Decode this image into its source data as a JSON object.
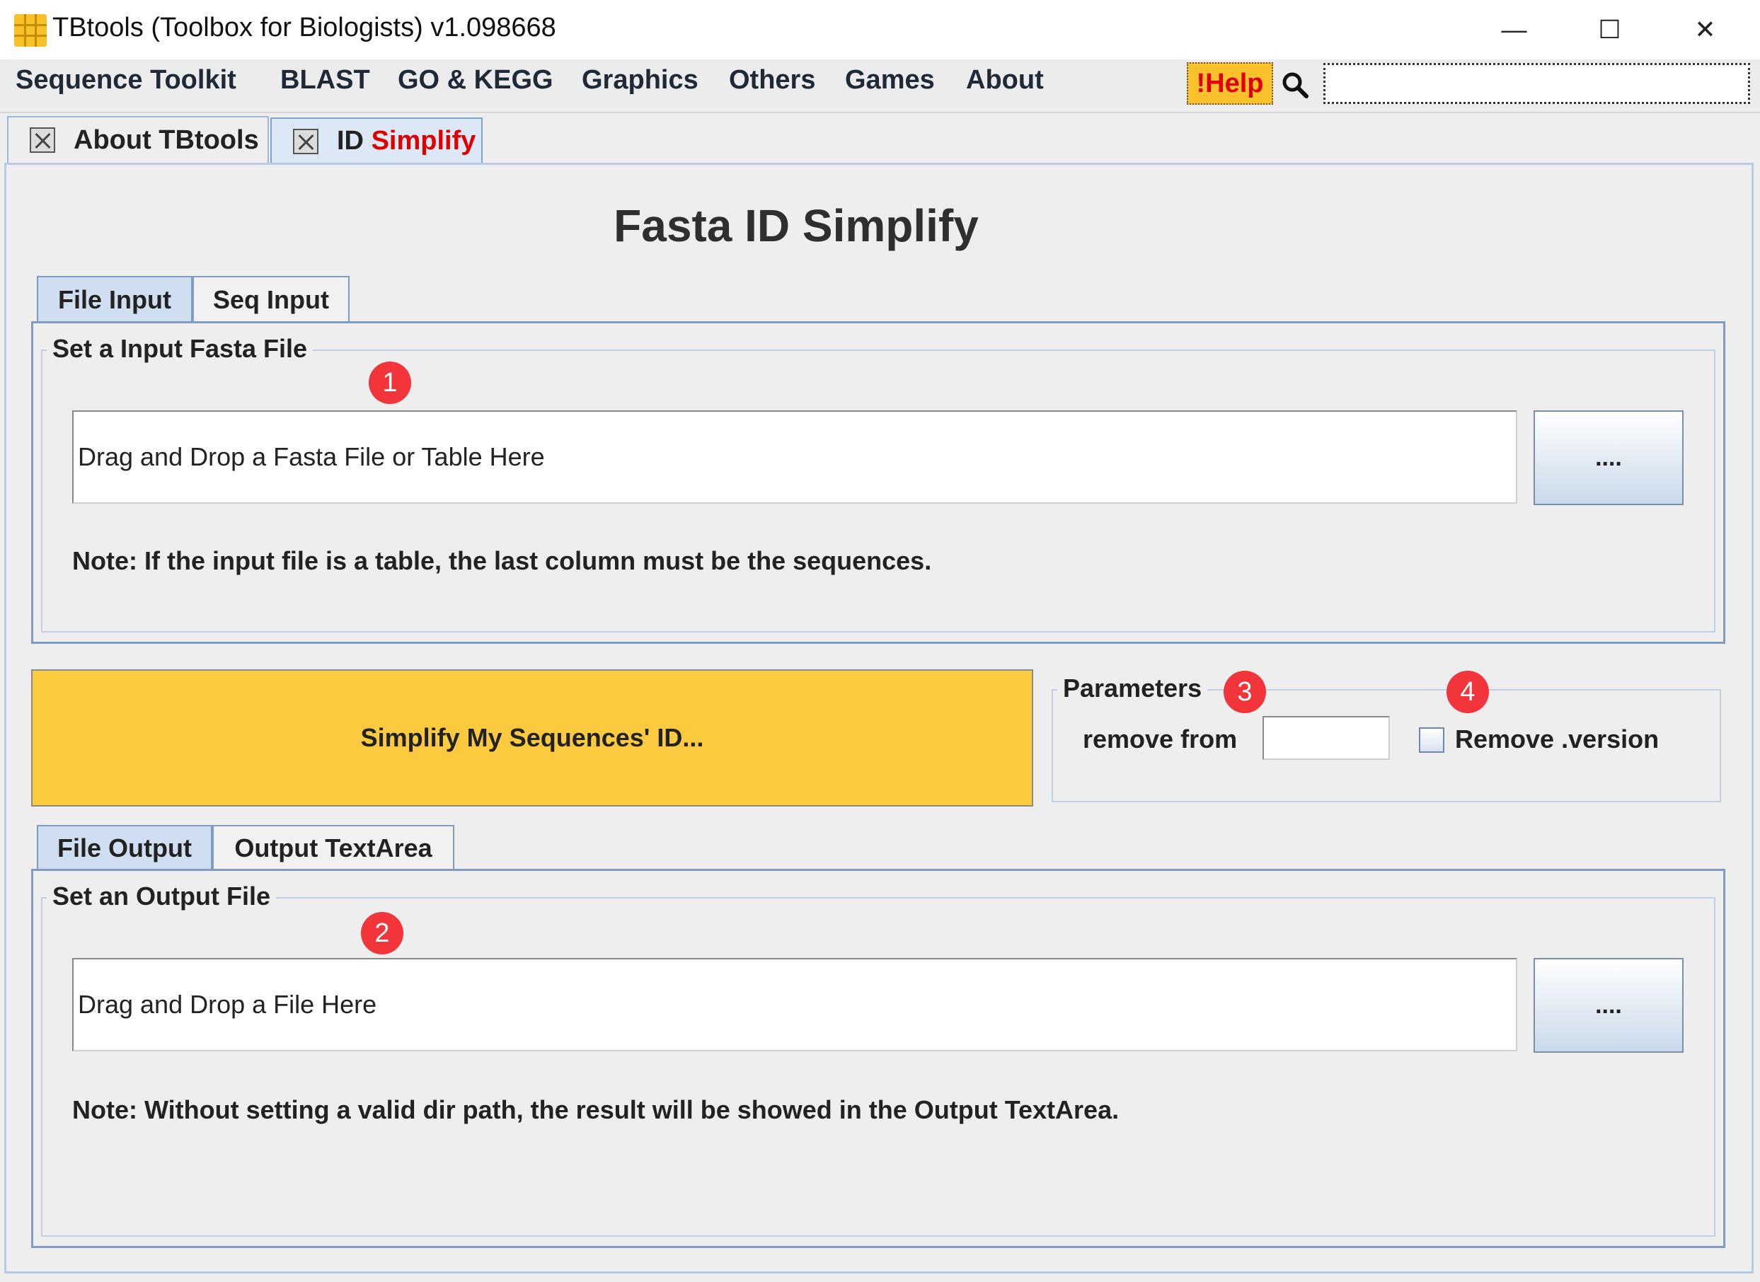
{
  "window": {
    "title": "TBtools (Toolbox for Biologists) v1.098668",
    "minimize_glyph": "—",
    "maximize_glyph": "☐",
    "close_glyph": "✕"
  },
  "menu": {
    "items": [
      "Sequence Toolkit",
      "BLAST",
      "GO & KEGG",
      "Graphics",
      "Others",
      "Games",
      "About"
    ],
    "help_label": "!Help",
    "search_value": ""
  },
  "top_tabs": [
    {
      "prefix": "About TBtools",
      "accent": ""
    },
    {
      "prefix": "ID ",
      "accent": "Simplify"
    }
  ],
  "page": {
    "heading": "Fasta ID Simplify"
  },
  "input_section": {
    "tabs": [
      "File Input",
      "Seq Input"
    ],
    "group_label": "Set a Input Fasta File",
    "field_text": "Drag and Drop a Fasta File or Table Here",
    "browse_label": "....",
    "note": "Note: If the input file is a table, the last column must be the sequences."
  },
  "action": {
    "run_label": "Simplify My Sequences' ID..."
  },
  "parameters": {
    "group_label": "Parameters",
    "remove_from_label": "remove from",
    "remove_from_value": "",
    "remove_version_label": "Remove .version",
    "remove_version_checked": false
  },
  "output_section": {
    "tabs": [
      "File Output",
      "Output TextArea"
    ],
    "group_label": "Set an Output File",
    "field_text": "Drag and Drop a File Here",
    "browse_label": "....",
    "note": "Note: Without setting a valid dir path, the result will be showed in the Output TextArea."
  },
  "badges": [
    "1",
    "2",
    "3",
    "4"
  ],
  "colors": {
    "accent_yellow": "#fcca3e",
    "help_text": "#e00000",
    "tab_accent_text": "#e00000",
    "badge": "#f2353a",
    "tab_border": "#7f9dc2"
  }
}
